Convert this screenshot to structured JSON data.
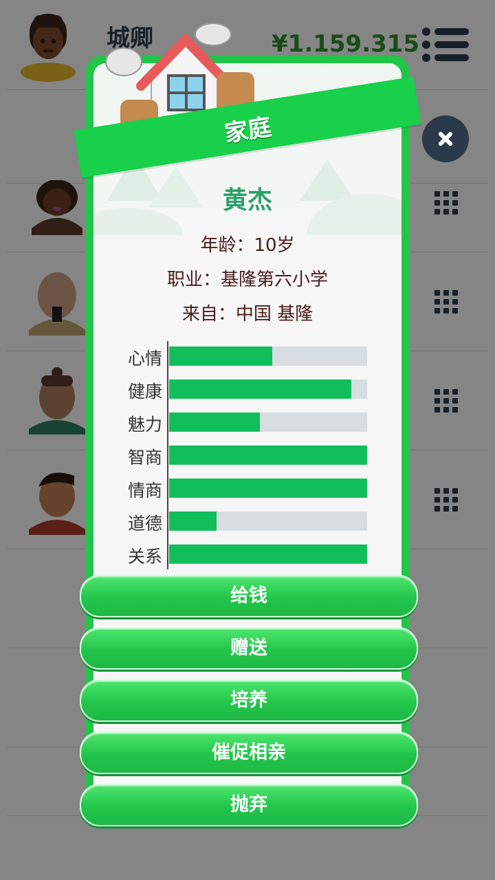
{
  "header": {
    "player_name": "城卿",
    "money": "¥1.159.315"
  },
  "dialog": {
    "title": "家庭",
    "name": "黄杰",
    "age_line": "年龄：10岁",
    "job_line": "职业：基隆第六小学",
    "from_line": "来自：中国 基隆",
    "stats": [
      {
        "label": "心情",
        "value": 0.52
      },
      {
        "label": "健康",
        "value": 0.92
      },
      {
        "label": "魅力",
        "value": 0.46
      },
      {
        "label": "智商",
        "value": 1.0
      },
      {
        "label": "情商",
        "value": 1.0
      },
      {
        "label": "道德",
        "value": 0.24
      },
      {
        "label": "关系",
        "value": 1.0
      }
    ],
    "buttons": [
      "给钱",
      "赠送",
      "培养",
      "催促相亲",
      "抛弃"
    ]
  },
  "colors": {
    "accent_green": "#22c44a",
    "bar_fill": "#12be5a",
    "bar_track": "#d8dde2",
    "name_color": "#2aa06a"
  },
  "icons": [
    "menu-icon",
    "close-icon",
    "grid-icon",
    "house-icon"
  ]
}
